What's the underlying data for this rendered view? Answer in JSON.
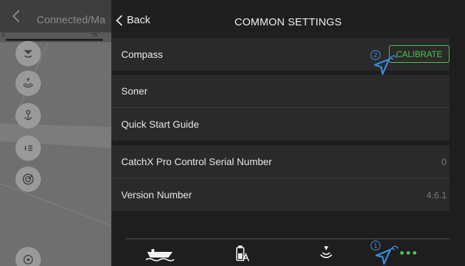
{
  "background_app": {
    "title": "Connected/Ma",
    "scale_min": "0",
    "scale_max": "75"
  },
  "header": {
    "back_label": "Back",
    "title": "COMMON SETTINGS"
  },
  "settings": {
    "compass_label": "Compass",
    "calibrate_label": "CALIBRATE",
    "sonar_label": "Soner",
    "quick_start_label": "Quick Start Guide",
    "serial_label": "CatchX Pro Control Serial Number",
    "serial_value": "0",
    "version_label": "Version Number",
    "version_value": "4.6.1"
  },
  "annotations": {
    "step_1": "1",
    "step_2": "2"
  },
  "colors": {
    "accent_green": "#4cc94a",
    "annotation_blue": "#3b8ee6"
  },
  "icons": [
    "back-chevron-icon",
    "boat-icon",
    "fuel-gauge-icon",
    "sonar-icon",
    "more-dots-icon",
    "pointer-icon"
  ]
}
